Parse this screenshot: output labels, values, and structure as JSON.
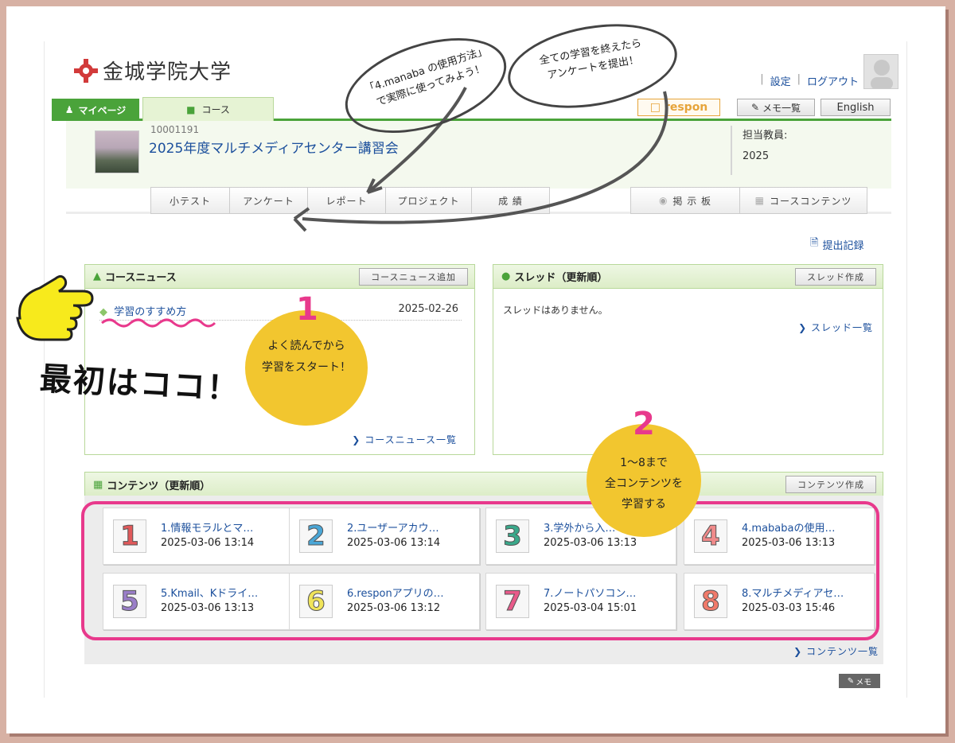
{
  "header": {
    "logo_text": "金城学院大学",
    "settings": "設定",
    "logout": "ログアウト",
    "sep": "|"
  },
  "tabs": {
    "mypage": "マイページ",
    "course": "コース",
    "respon": "respon",
    "memo_list": "メモ一覧",
    "english": "English"
  },
  "course": {
    "id": "10001191",
    "title": "2025年度マルチメディアセンター講習会",
    "teacher_label": "担当教員:",
    "teacher_value": "2025"
  },
  "subtabs": [
    "小テスト",
    "アンケート",
    "レポート",
    "プロジェクト",
    "成 績"
  ],
  "subtabs_right": [
    "掲 示 板",
    "コースコンテンツ"
  ],
  "submit_record": "提出記録",
  "news": {
    "title": "コースニュース",
    "add_button": "コースニュース追加",
    "items": [
      {
        "title": "学習のすすめ方",
        "date": "2025-02-26"
      }
    ],
    "more": "コースニュース一覧"
  },
  "threads": {
    "title": "スレッド（更新順）",
    "create_button": "スレッド作成",
    "empty": "スレッドはありません。",
    "more": "スレッド一覧"
  },
  "contents": {
    "title": "コンテンツ（更新順）",
    "create_button": "コンテンツ作成",
    "more": "コンテンツ一覧",
    "memo": "メモ",
    "items": [
      {
        "num": "1",
        "color": "#e0595a",
        "title": "1.情報モラルとマ…",
        "date": "2025-03-06 13:14"
      },
      {
        "num": "2",
        "color": "#4aa6d6",
        "title": "2.ユーザーアカウ…",
        "date": "2025-03-06 13:14"
      },
      {
        "num": "3",
        "color": "#3aa88a",
        "title": "3.学外から入…",
        "date": "2025-03-06 13:13"
      },
      {
        "num": "4",
        "color": "#f08a8a",
        "title": "4.mababaの使用…",
        "date": "2025-03-06 13:13"
      },
      {
        "num": "5",
        "color": "#9a7ec8",
        "title": "5.Kmail、Kドライ…",
        "date": "2025-03-06 13:13"
      },
      {
        "num": "6",
        "color": "#f0e45a",
        "title": "6.responアプリの…",
        "date": "2025-03-06 13:12"
      },
      {
        "num": "7",
        "color": "#e85a8a",
        "title": "7.ノートパソコン…",
        "date": "2025-03-04 15:01"
      },
      {
        "num": "8",
        "color": "#f07a6a",
        "title": "8.マルチメディアセ…",
        "date": "2025-03-03 15:46"
      }
    ]
  },
  "annotations": {
    "bubble1_line1": "「4.manaba の使用方法」",
    "bubble1_line2": "で実際に使ってみよう！",
    "bubble2_line1": "全ての学習を終えたら",
    "bubble2_line2": "アンケートを提出！",
    "circle1_num": "1",
    "circle1_line1": "よく読んでから",
    "circle1_line2": "学習をスタート！",
    "circle2_num": "2",
    "circle2_line1": "1～8まで",
    "circle2_line2": "全コンテンツを",
    "circle2_line3": "学習する",
    "first_here": "最初はココ！"
  },
  "colors": {
    "green_accent": "#4aa33a",
    "pink_accent": "#e8398c",
    "yellow_circle": "#f2c62f",
    "link_blue": "#1b4f9c"
  }
}
